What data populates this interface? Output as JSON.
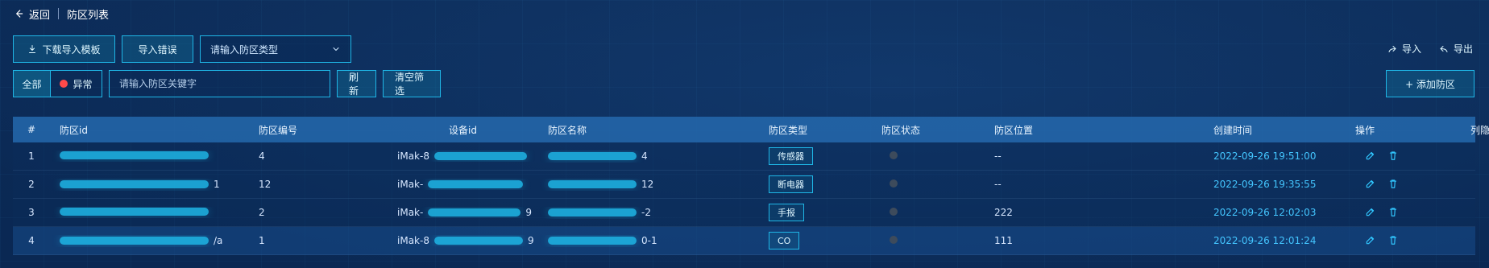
{
  "header": {
    "back_label": "返回",
    "title": "防区列表"
  },
  "toolbar": {
    "download_template_label": "下载导入模板",
    "import_errors_label": "导入错误",
    "zone_type_placeholder": "请输入防区类型",
    "filter_all_label": "全部",
    "filter_abnormal_label": "异常",
    "keyword_placeholder": "请输入防区关键字",
    "refresh_label": "刷新",
    "clear_filters_label": "清空筛选",
    "import_label": "导入",
    "export_label": "导出",
    "add_zone_label": "+ 添加防区"
  },
  "table": {
    "headers": [
      "#",
      "防区id",
      "防区编号",
      "设备id",
      "防区名称",
      "防区类型",
      "防区状态",
      "防区位置",
      "创建时间",
      "操作",
      "列隐藏"
    ],
    "rows": [
      {
        "idx": "1",
        "zone_id_suffix": "",
        "zone_no": "4",
        "device_prefix": "iMak-8",
        "device_suffix": "",
        "zone_name_suffix": "4",
        "zone_type": "传感器",
        "zone_location": "--",
        "created_time": "2022-09-26 19:51:00"
      },
      {
        "idx": "2",
        "zone_id_suffix": "1",
        "zone_no": "12",
        "device_prefix": "iMak-",
        "device_suffix": "",
        "zone_name_suffix": "12",
        "zone_type": "断电器",
        "zone_location": "--",
        "created_time": "2022-09-26 19:35:55"
      },
      {
        "idx": "3",
        "zone_id_suffix": "",
        "zone_no": "2",
        "device_prefix": "iMak-",
        "device_suffix": "9",
        "zone_name_suffix": "-2",
        "zone_type": "手报",
        "zone_location": "222",
        "created_time": "2022-09-26 12:02:03"
      },
      {
        "idx": "4",
        "zone_id_suffix": "/a",
        "zone_no": "1",
        "device_prefix": "iMak-8",
        "device_suffix": "9",
        "zone_name_suffix": "0-1",
        "zone_type": "CO",
        "zone_location": "111",
        "created_time": "2022-09-26 12:01:24"
      }
    ]
  },
  "colors": {
    "accent": "#1fb6e6",
    "time": "#44c6ff",
    "abnormal_dot": "#ff4a4a",
    "status_dot": "#3d4b5c"
  }
}
